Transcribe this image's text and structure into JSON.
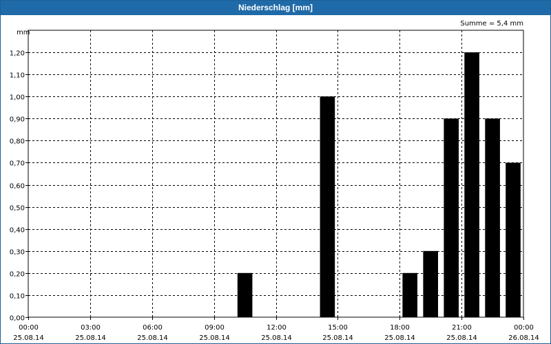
{
  "window": {
    "title": "Niederschlag [mm]"
  },
  "chart_data": {
    "type": "bar",
    "title": "Niederschlag [mm]",
    "ylabel": "mm",
    "sum_label": "Summe = 5,4 mm",
    "ylim": [
      0,
      1.3
    ],
    "y_ticks": [
      {
        "value": 0.0,
        "label": "0,00"
      },
      {
        "value": 0.1,
        "label": "0,10"
      },
      {
        "value": 0.2,
        "label": "0,20"
      },
      {
        "value": 0.3,
        "label": "0,30"
      },
      {
        "value": 0.4,
        "label": "0,40"
      },
      {
        "value": 0.5,
        "label": "0,50"
      },
      {
        "value": 0.6,
        "label": "0,60"
      },
      {
        "value": 0.7,
        "label": "0,70"
      },
      {
        "value": 0.8,
        "label": "0,80"
      },
      {
        "value": 0.9,
        "label": "0,90"
      },
      {
        "value": 1.0,
        "label": "1,00"
      },
      {
        "value": 1.1,
        "label": "1,10"
      },
      {
        "value": 1.2,
        "label": "1,20"
      }
    ],
    "xlim_hours": [
      0,
      24
    ],
    "x_ticks": [
      {
        "hour": 0,
        "time": "00:00",
        "date": "25.08.14"
      },
      {
        "hour": 3,
        "time": "03:00",
        "date": "25.08.14"
      },
      {
        "hour": 6,
        "time": "06:00",
        "date": "25.08.14"
      },
      {
        "hour": 9,
        "time": "09:00",
        "date": "25.08.14"
      },
      {
        "hour": 12,
        "time": "12:00",
        "date": "25.08.14"
      },
      {
        "hour": 15,
        "time": "15:00",
        "date": "25.08.14"
      },
      {
        "hour": 18,
        "time": "18:00",
        "date": "25.08.14"
      },
      {
        "hour": 21,
        "time": "21:00",
        "date": "25.08.14"
      },
      {
        "hour": 24,
        "time": "00:00",
        "date": "26.08.14"
      }
    ],
    "bars": [
      {
        "hour": 10,
        "value": 0.2
      },
      {
        "hour": 14,
        "value": 1.0
      },
      {
        "hour": 18,
        "value": 0.2
      },
      {
        "hour": 19,
        "value": 0.3
      },
      {
        "hour": 20,
        "value": 0.9
      },
      {
        "hour": 21,
        "value": 1.2
      },
      {
        "hour": 22,
        "value": 0.9
      },
      {
        "hour": 23,
        "value": 0.7
      }
    ],
    "grid": true
  }
}
